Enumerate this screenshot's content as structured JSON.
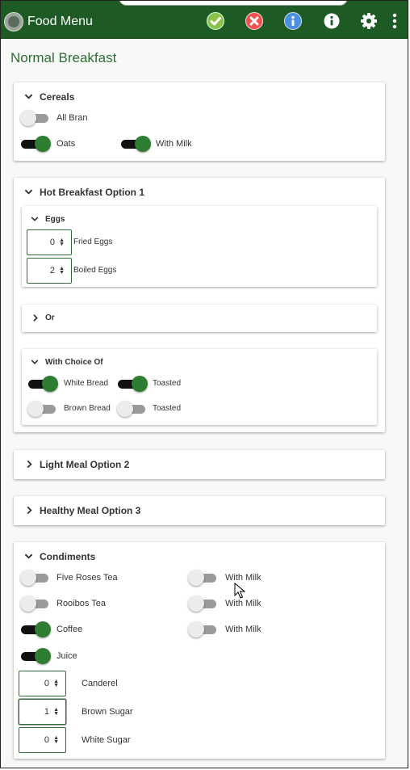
{
  "app": {
    "title": "Food Menu"
  },
  "toolbar": {
    "icons": [
      "check-icon",
      "cancel-icon",
      "info-icon",
      "info-icon",
      "gear-icon",
      "more-icon"
    ]
  },
  "page": {
    "title": "Normal Breakfast"
  },
  "cereals": {
    "title": "Cereals",
    "items": [
      {
        "label": "All Bran",
        "on": false
      },
      {
        "label": "Oats",
        "on": true
      },
      {
        "label": "With Milk",
        "on": true
      }
    ]
  },
  "hot": {
    "title": "Hot Breakfast Option 1",
    "eggs": {
      "title": "Eggs",
      "fried": {
        "value": "0",
        "label": "Fried Eggs"
      },
      "boiled": {
        "value": "2",
        "label": "Boiled Eggs"
      }
    },
    "or": {
      "title": "Or"
    },
    "choice": {
      "title": "With Choice Of",
      "white_bread": {
        "label": "White Bread",
        "on": true
      },
      "white_toasted": {
        "label": "Toasted",
        "on": true
      },
      "brown_bread": {
        "label": "Brown Bread",
        "on": false
      },
      "brown_toasted": {
        "label": "Toasted",
        "on": false
      }
    }
  },
  "light": {
    "title": "Light Meal Option 2"
  },
  "healthy": {
    "title": "Healthy Meal Option 3"
  },
  "condiments": {
    "title": "Condiments",
    "five_roses": {
      "label": "Five Roses Tea",
      "on": false
    },
    "five_roses_milk": {
      "label": "With Milk",
      "on": false
    },
    "rooibos": {
      "label": "Rooibos Tea",
      "on": false
    },
    "rooibos_milk": {
      "label": "With Milk",
      "on": false
    },
    "coffee": {
      "label": "Coffee",
      "on": true
    },
    "coffee_milk": {
      "label": "With Milk",
      "on": false
    },
    "juice": {
      "label": "Juice",
      "on": true
    },
    "canderel": {
      "value": "0",
      "label": "Canderel"
    },
    "brown_sugar": {
      "value": "1",
      "label": "Brown Sugar"
    },
    "white_sugar": {
      "value": "0",
      "label": "White Sugar"
    }
  },
  "colors": {
    "appbar": "#1e5b24",
    "accent": "#2e7d32",
    "title": "#2e6d33"
  }
}
